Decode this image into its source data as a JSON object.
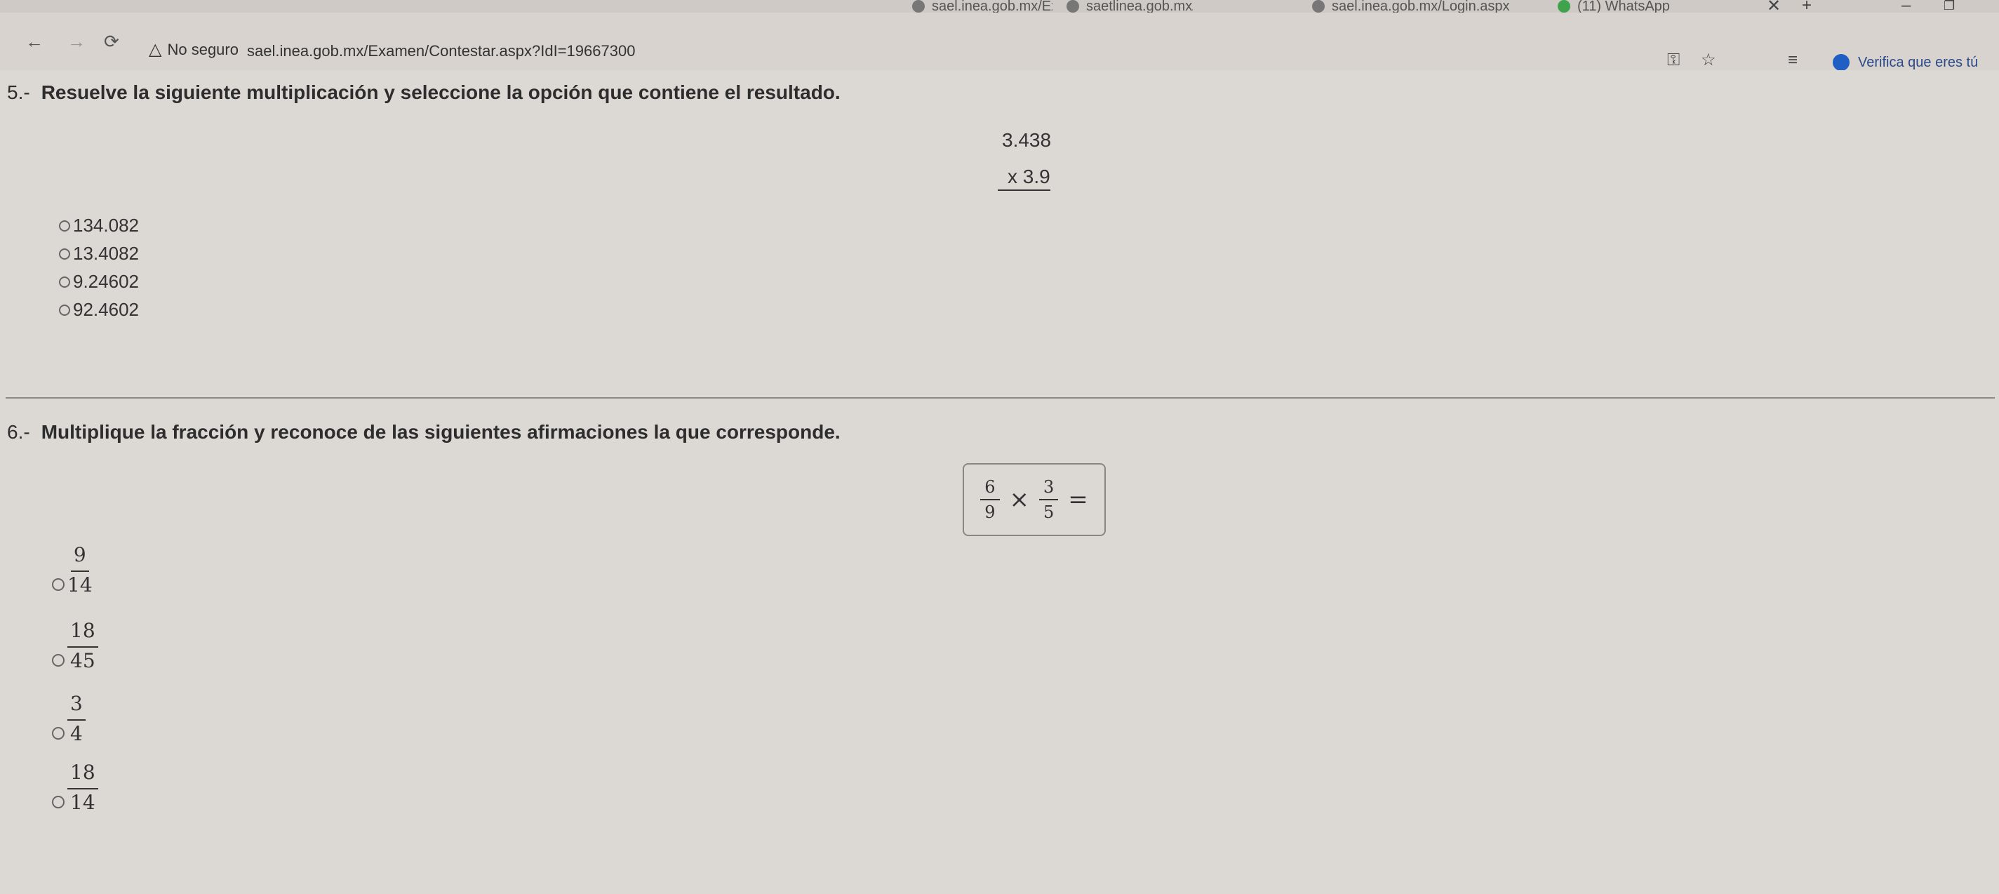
{
  "browser": {
    "tabs": [
      {
        "label": "saetlinea.gob.mx/Examen/Con",
        "favicon": "globe-icon"
      },
      {
        "label": "sael.inea.gob.mx/Examen/Con",
        "favicon": "globe-icon"
      },
      {
        "label": "sael.inea.gob.mx/Login.aspx",
        "favicon": "globe-icon"
      },
      {
        "label": "(11) WhatsApp",
        "favicon": "whatsapp-icon"
      }
    ],
    "security_label": "No seguro",
    "url": "sael.inea.gob.mx/Examen/Contestar.aspx?IdI=19667300",
    "profile_label": "Verifica que eres tú"
  },
  "questions": {
    "q5": {
      "number": "5.-",
      "text": "Resuelve la siguiente multiplicación y seleccione la opción que contiene el resultado.",
      "operand_top": "3.438",
      "operand_bottom": "x 3.9",
      "options": [
        "134.082",
        "13.4082",
        "9.24602",
        "92.4602"
      ]
    },
    "q6": {
      "number": "6.-",
      "text": "Multiplique la fracción y reconoce de las siguientes afirmaciones la que corresponde.",
      "expression": {
        "a_num": "6",
        "a_den": "9",
        "op": "×",
        "b_num": "3",
        "b_den": "5",
        "eq": "="
      },
      "options": [
        {
          "num": "9",
          "den": "14"
        },
        {
          "num": "18",
          "den": "45"
        },
        {
          "num": "3",
          "den": "4"
        },
        {
          "num": "18",
          "den": "14"
        }
      ]
    }
  }
}
